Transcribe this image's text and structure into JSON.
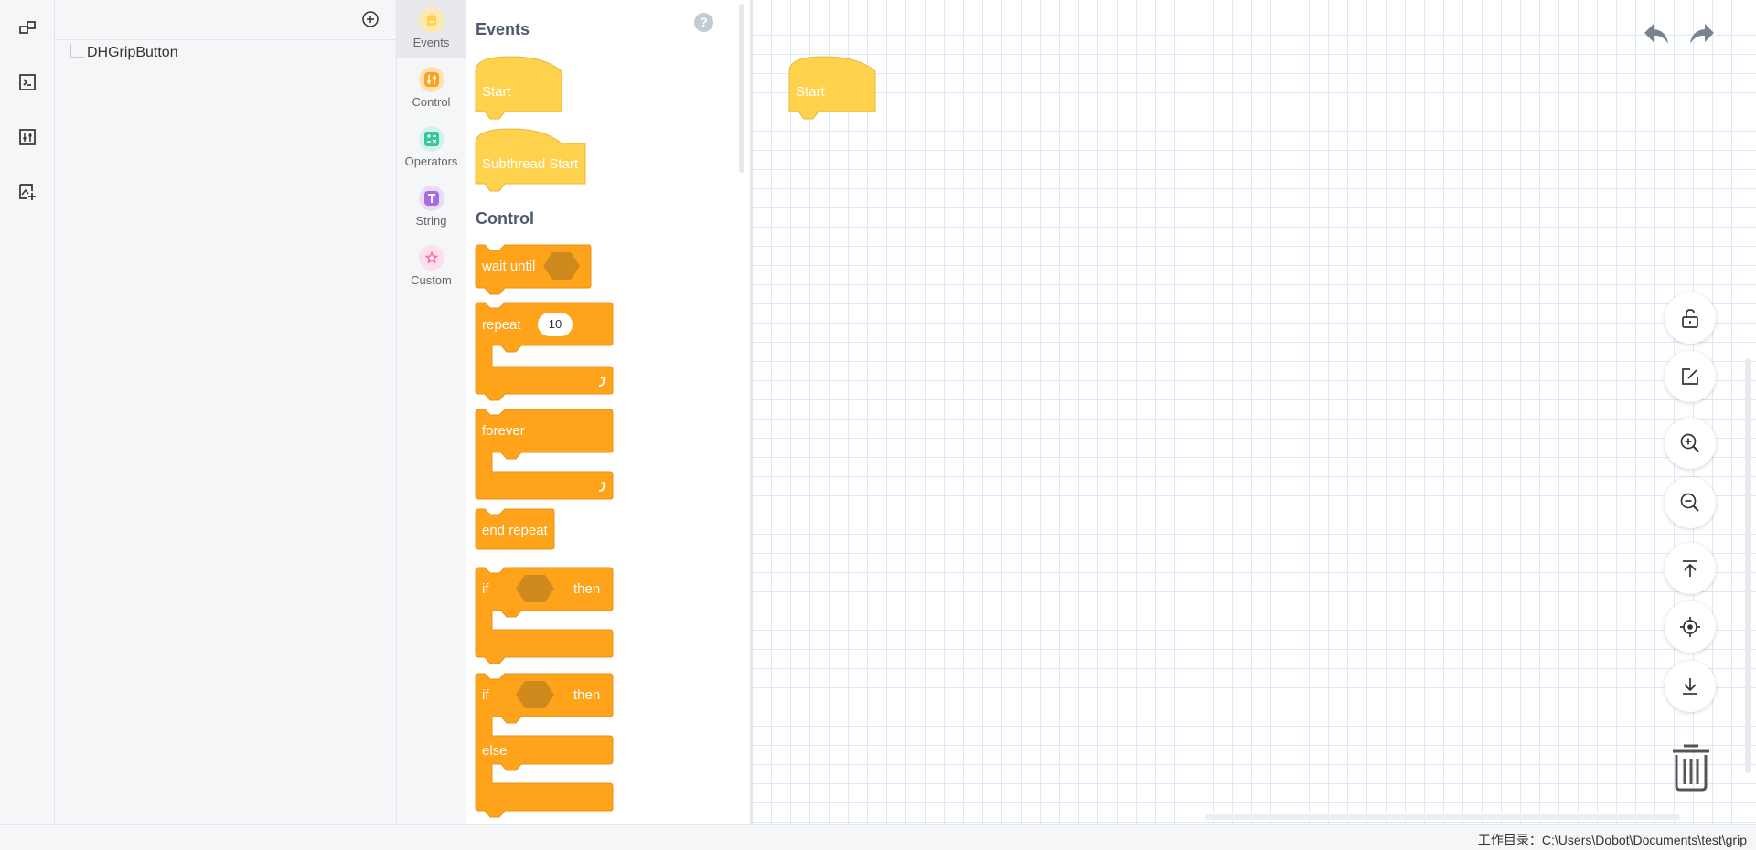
{
  "sidebar": {
    "icons": [
      "blocks-icon",
      "terminal-icon",
      "sliders-icon",
      "image-add-icon"
    ]
  },
  "tree": {
    "add_icon": "plus-circle-icon",
    "items": [
      {
        "label": "DHGripButton"
      }
    ]
  },
  "categories": [
    {
      "label": "Events",
      "color": "#ffd14d"
    },
    {
      "label": "Control",
      "color": "#ffa31a"
    },
    {
      "label": "Operators",
      "color": "#33c69f"
    },
    {
      "label": "String",
      "color": "#a86ae6"
    },
    {
      "label": "Custom",
      "color": "#ff6fa8"
    }
  ],
  "palette": {
    "help_label": "?",
    "events_title": "Events",
    "control_title": "Control",
    "blocks": {
      "start": "Start",
      "subthread_start": "Subthread Start",
      "wait_until": "wait until",
      "repeat": "repeat",
      "repeat_count": "10",
      "forever": "forever",
      "end_repeat": "end repeat",
      "if": "if",
      "then": "then",
      "if2": "if",
      "then2": "then",
      "else": "else"
    },
    "colors": {
      "event": "#ffd24e",
      "event_edge": "#e8b83a",
      "control": "#ffa31a",
      "control_edge": "#e6901a",
      "hex": "#cf8a1e"
    }
  },
  "workspace": {
    "start_block": "Start",
    "toolbar_icons": [
      "undo-icon",
      "redo-icon"
    ],
    "side_buttons": [
      "unlock-icon",
      "edit-icon",
      "zoom-in-icon",
      "zoom-out-icon",
      "to-top-icon",
      "locate-icon",
      "download-icon"
    ],
    "trash_icon": "trash-icon"
  },
  "status": {
    "workdir": "工作目录：C:\\Users\\Dobot\\Documents\\test\\grip"
  }
}
